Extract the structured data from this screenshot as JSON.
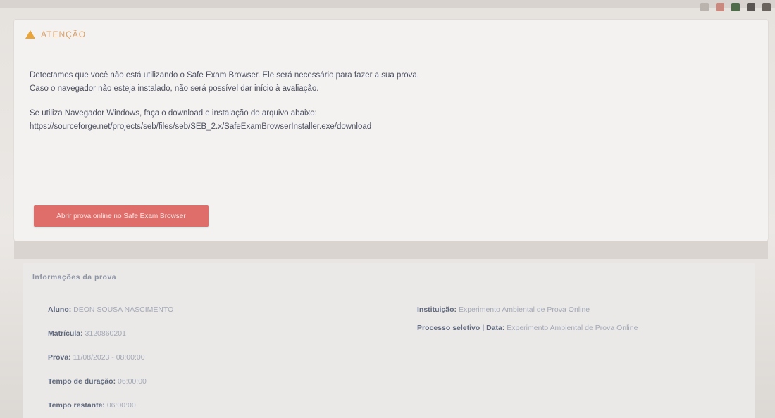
{
  "alert": {
    "title": "ATENÇÃO",
    "lines": [
      "Detectamos que você não está utilizando o Safe Exam Browser. Ele será necessário para fazer a sua prova.",
      "Caso o navegador não esteja instalado, não será possível dar início à avaliação.",
      "Se utiliza Navegador Windows, faça o download e instalação do arquivo abaixo:",
      "https://sourceforge.net/projects/seb/files/seb/SEB_2.x/SafeExamBrowserInstaller.exe/download"
    ],
    "button_label": "Abrir prova online no Safe Exam Browser"
  },
  "info": {
    "title": "Informações da prova",
    "left": [
      {
        "label": "Aluno:",
        "value": "DEON SOUSA NASCIMENTO"
      },
      {
        "label": "Matrícula:",
        "value": "3120860201"
      },
      {
        "label": "Prova:",
        "value": "11/08/2023 - 08:00:00"
      },
      {
        "label": "Tempo de duração:",
        "value": "06:00:00"
      },
      {
        "label": "Tempo restante:",
        "value": "06:00:00"
      }
    ],
    "right": [
      {
        "label": "Instituição:",
        "value": "Experimento Ambiental de Prova Online"
      },
      {
        "label": "Processo seletivo | Data:",
        "value": "Experimento Ambiental de Prova Online"
      }
    ]
  },
  "colors": {
    "button": "#df6e6a",
    "warning_icon": "#e9a43a",
    "title": "#d9a06a"
  }
}
